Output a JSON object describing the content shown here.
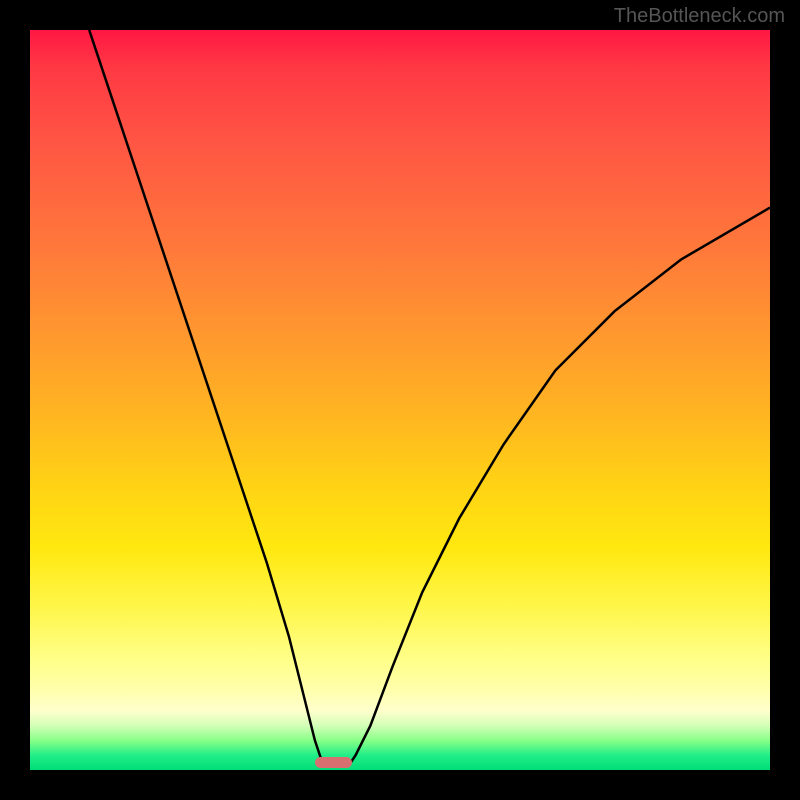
{
  "watermark": "TheBottleneck.com",
  "chart_data": {
    "type": "line",
    "title": "",
    "xlabel": "",
    "ylabel": "",
    "xlim": [
      0,
      100
    ],
    "ylim": [
      0,
      100
    ],
    "curve_left": [
      {
        "x": 8,
        "y": 100
      },
      {
        "x": 12,
        "y": 88
      },
      {
        "x": 16,
        "y": 76
      },
      {
        "x": 20,
        "y": 64
      },
      {
        "x": 24,
        "y": 52
      },
      {
        "x": 28,
        "y": 40
      },
      {
        "x": 32,
        "y": 28
      },
      {
        "x": 35,
        "y": 18
      },
      {
        "x": 37,
        "y": 10
      },
      {
        "x": 38.5,
        "y": 4
      },
      {
        "x": 39.5,
        "y": 1
      },
      {
        "x": 40,
        "y": 0.5
      }
    ],
    "curve_right": [
      {
        "x": 43,
        "y": 0.5
      },
      {
        "x": 44,
        "y": 2
      },
      {
        "x": 46,
        "y": 6
      },
      {
        "x": 49,
        "y": 14
      },
      {
        "x": 53,
        "y": 24
      },
      {
        "x": 58,
        "y": 34
      },
      {
        "x": 64,
        "y": 44
      },
      {
        "x": 71,
        "y": 54
      },
      {
        "x": 79,
        "y": 62
      },
      {
        "x": 88,
        "y": 69
      },
      {
        "x": 100,
        "y": 76
      }
    ],
    "marker": {
      "x": 41,
      "y": 1,
      "width": 5,
      "height": 1.5
    },
    "gradient_colors": {
      "top": "#ff1744",
      "middle": "#ffeb3b",
      "bottom": "#00dd77"
    }
  }
}
